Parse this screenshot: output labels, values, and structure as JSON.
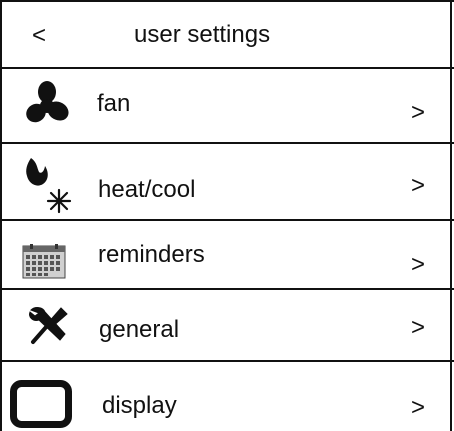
{
  "header": {
    "back_label": "<",
    "title": "user settings"
  },
  "menu": [
    {
      "label": "fan",
      "icon": "fan-icon",
      "chevron": ">"
    },
    {
      "label": "heat/cool",
      "icon": "flame-snowflake-icon",
      "chevron": ">"
    },
    {
      "label": "reminders",
      "icon": "calendar-icon",
      "chevron": ">"
    },
    {
      "label": "general",
      "icon": "wrench-screwdriver-icon",
      "chevron": ">"
    },
    {
      "label": "display",
      "icon": "display-icon",
      "chevron": ">"
    }
  ]
}
